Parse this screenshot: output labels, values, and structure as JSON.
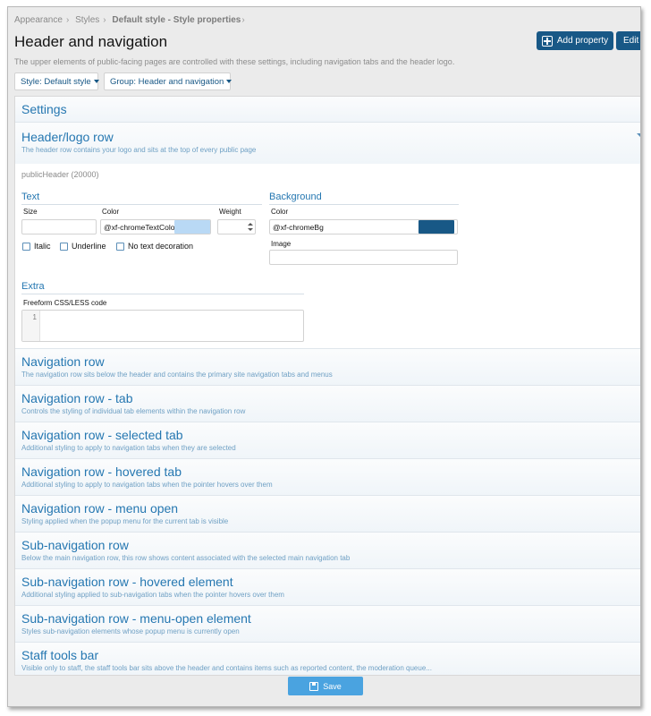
{
  "breadcrumb": {
    "items": [
      "Appearance",
      "Styles",
      "Default style - Style properties"
    ]
  },
  "header": {
    "title": "Header and navigation",
    "description": "The upper elements of public-facing pages are controlled with these settings, including navigation tabs and the header logo.",
    "add_property_label": "Add property",
    "edit_label": "Edit"
  },
  "filters": {
    "style": "Style: Default style",
    "group": "Group: Header and navigation"
  },
  "settings": {
    "title": "Settings"
  },
  "header_logo_row": {
    "title": "Header/logo row",
    "subtitle": "The header row contains your logo and sits at the top of every public page",
    "property_name": "publicHeader (20000)",
    "text_group": "Text",
    "size_label": "Size",
    "color_label": "Color",
    "weight_label": "Weight",
    "color_value": "@xf-chromeTextColor",
    "color_swatch": "#b9d9f5",
    "italic_label": "Italic",
    "underline_label": "Underline",
    "no_decoration_label": "No text decoration",
    "background_group": "Background",
    "bg_color_label": "Color",
    "bg_color_value": "@xf-chromeBg",
    "bg_color_swatch": "#185886",
    "image_label": "Image",
    "extra_group": "Extra",
    "freeform_label": "Freeform CSS/LESS code",
    "line_number": "1"
  },
  "sections": [
    {
      "title": "Navigation row",
      "subtitle": "The navigation row sits below the header and contains the primary site navigation tabs and menus"
    },
    {
      "title": "Navigation row - tab",
      "subtitle": "Controls the styling of individual tab elements within the navigation row"
    },
    {
      "title": "Navigation row - selected tab",
      "subtitle": "Additional styling to apply to navigation tabs when they are selected"
    },
    {
      "title": "Navigation row - hovered tab",
      "subtitle": "Additional styling to apply to navigation tabs when the pointer hovers over them"
    },
    {
      "title": "Navigation row - menu open",
      "subtitle": "Styling applied when the popup menu for the current tab is visible"
    },
    {
      "title": "Sub-navigation row",
      "subtitle": "Below the main navigation row, this row shows content associated with the selected main navigation tab"
    },
    {
      "title": "Sub-navigation row - hovered element",
      "subtitle": "Additional styling applied to sub-navigation tabs when the pointer hovers over them"
    },
    {
      "title": "Sub-navigation row - menu-open element",
      "subtitle": "Styles sub-navigation elements whose popup menu is currently open"
    },
    {
      "title": "Staff tools bar",
      "subtitle": "Visible only to staff, the staff tools bar sits above the header and contains items such as reported content, the moderation queue..."
    }
  ],
  "footer": {
    "save_label": "Save"
  }
}
